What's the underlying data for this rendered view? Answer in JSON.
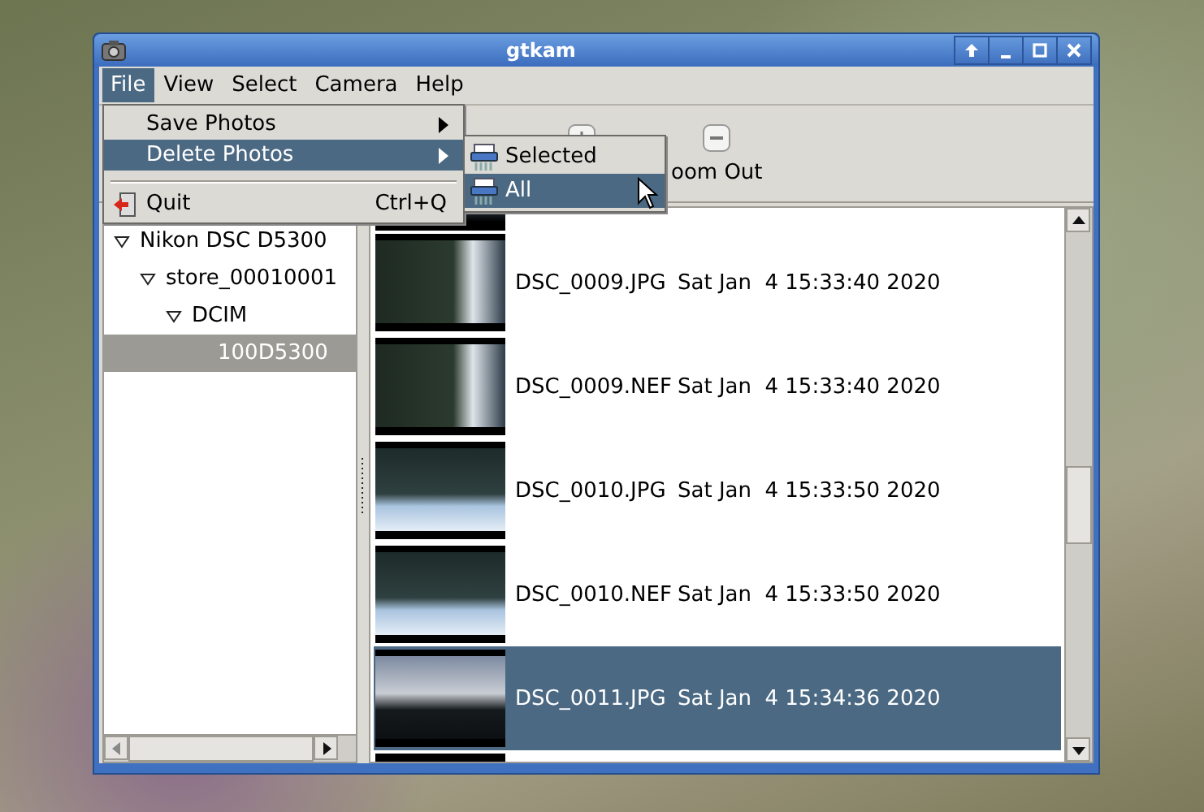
{
  "window": {
    "title": "gtkam"
  },
  "menubar": [
    {
      "label": "File",
      "selected": true
    },
    {
      "label": "View",
      "selected": false
    },
    {
      "label": "Select",
      "selected": false
    },
    {
      "label": "Camera",
      "selected": false
    },
    {
      "label": "Help",
      "selected": false
    }
  ],
  "file_menu": [
    {
      "kind": "submenu",
      "label": "Save Photos",
      "selected": false
    },
    {
      "kind": "submenu",
      "label": "Delete Photos",
      "selected": true
    },
    {
      "kind": "separator"
    },
    {
      "kind": "action",
      "label": "Quit",
      "shortcut": "Ctrl+Q",
      "selected": false
    }
  ],
  "delete_submenu": [
    {
      "label": "Selected",
      "selected": false
    },
    {
      "label": "All",
      "selected": true
    }
  ],
  "toolbar": [
    {
      "label": "oom Out"
    }
  ],
  "tree": [
    {
      "label": "Nikon DSC D5300",
      "expanded": true,
      "selected": false,
      "children": [
        {
          "label": "store_00010001",
          "expanded": true,
          "selected": false,
          "children": [
            {
              "label": "DCIM",
              "expanded": true,
              "selected": false,
              "children": [
                {
                  "label": "100D5300",
                  "selected": true
                }
              ]
            }
          ]
        }
      ]
    }
  ],
  "photos": [
    {
      "name": "DSC_0009.JPG",
      "date": "Sat Jan  4 15:33:40 2020",
      "selected": false
    },
    {
      "name": "DSC_0009.NEF",
      "date": "Sat Jan  4 15:33:40 2020",
      "selected": false
    },
    {
      "name": "DSC_0010.JPG",
      "date": "Sat Jan  4 15:33:50 2020",
      "selected": false
    },
    {
      "name": "DSC_0010.NEF",
      "date": "Sat Jan  4 15:33:50 2020",
      "selected": false
    },
    {
      "name": "DSC_0011.JPG",
      "date": "Sat Jan  4 15:34:36 2020",
      "selected": true
    }
  ]
}
